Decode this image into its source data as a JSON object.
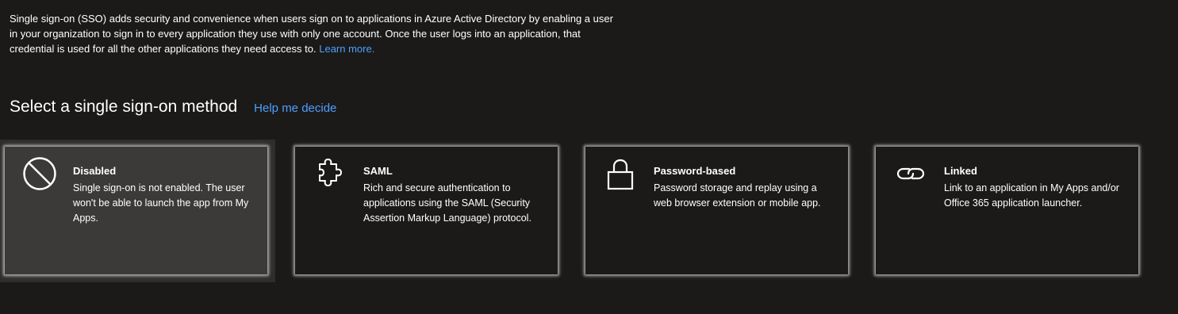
{
  "intro": {
    "text": "Single sign-on (SSO) adds security and convenience when users sign on to applications in Azure Active Directory by enabling a user in your organization to sign in to every application they use with only one account. Once the user logs into an application, that credential is used for all the other applications they need access to.",
    "learn_more": "Learn more."
  },
  "section": {
    "heading": "Select a single sign-on method",
    "help_link": "Help me decide"
  },
  "cards": [
    {
      "icon": "disabled-icon",
      "title": "Disabled",
      "description": "Single sign-on is not enabled. The user won't be able to launch the app from My Apps."
    },
    {
      "icon": "puzzle-piece-icon",
      "title": "SAML",
      "description": "Rich and secure authentication to applications using the SAML (Security Assertion Markup Language) protocol."
    },
    {
      "icon": "lock-icon",
      "title": "Password-based",
      "description": "Password storage and replay using a web browser extension or mobile app."
    },
    {
      "icon": "link-icon",
      "title": "Linked",
      "description": "Link to an application in My Apps and/or Office 365 application launcher."
    }
  ],
  "colors": {
    "background": "#1b1a19",
    "selected_card": "#3b3a39",
    "link": "#4f9fff"
  }
}
